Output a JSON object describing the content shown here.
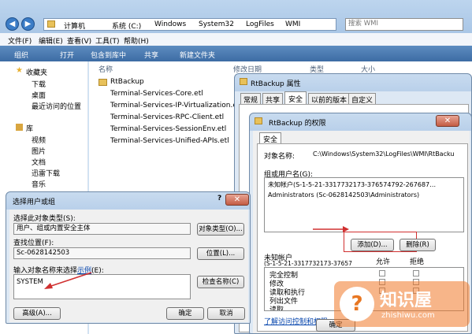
{
  "address": {
    "crumbs": [
      "计算机",
      "系统 (C:)",
      "Windows",
      "System32",
      "LogFiles",
      "WMI"
    ],
    "search_placeholder": "搜索 WMI"
  },
  "menu": [
    "文件(F)",
    "编辑(E)",
    "查看(V)",
    "工具(T)",
    "帮助(H)"
  ],
  "toolbar": [
    "组织",
    "打开",
    "包含到库中",
    "共享",
    "新建文件夹"
  ],
  "sidebar": {
    "favorites": "收藏夹",
    "fav_items": [
      "下载",
      "桌面",
      "最近访问的位置"
    ],
    "library": "库",
    "lib_items": [
      "视频",
      "图片",
      "文档",
      "迅雷下载",
      "音乐"
    ]
  },
  "columns": {
    "name": "名称",
    "date": "修改日期",
    "type": "类型",
    "size": "大小"
  },
  "files": [
    "RtBackup",
    "Terminal-Services-Core.etl",
    "Terminal-Services-IP-Virtualization.etl",
    "Terminal-Services-RPC-Client.etl",
    "Terminal-Services-SessionEnv.etl",
    "Terminal-Services-Unified-APIs.etl"
  ],
  "props": {
    "title": "RtBackup 属性",
    "tabs": [
      "常规",
      "共享",
      "安全",
      "以前的版本",
      "自定义"
    ]
  },
  "perm": {
    "title": "RtBackup 的权限",
    "tab": "安全",
    "object_label": "对象名称:",
    "object_value": "C:\\Windows\\System32\\LogFiles\\WMI\\RtBacku",
    "group_label": "组或用户名(G):",
    "users": [
      "未知帐户(S-1-5-21-3317732173-376574792-267687…",
      "Administrators (Sc-0628142503\\Administrators)"
    ],
    "add": "添加(D)...",
    "remove": "删除(R)",
    "perm_for": "未知帐户",
    "perm_for2": "(S-1-5-21-3317732173-37657",
    "allow": "允许",
    "deny": "拒绝",
    "rows": [
      "完全控制",
      "修改",
      "读取和执行",
      "列出文件",
      "读取"
    ],
    "link": "了解访问控制和权限",
    "ok": "确定"
  },
  "select": {
    "title": "选择用户或组",
    "type_label": "选择此对象类型(S):",
    "type_value": "用户、组或内置安全主体",
    "type_btn": "对象类型(O)...",
    "loc_label": "查找位置(F):",
    "loc_value": "Sc-0628142503",
    "loc_btn": "位置(L)...",
    "name_label": "输入对象名称来选择",
    "name_link": "示例",
    "name_label_end": "(E):",
    "name_value": "SYSTEM",
    "check_btn": "检查名称(C)",
    "adv_btn": "高级(A)...",
    "ok": "确定",
    "cancel": "取消",
    "help": "?"
  },
  "watermark": {
    "brand": "知识屋",
    "url": "zhishiwu.com"
  }
}
